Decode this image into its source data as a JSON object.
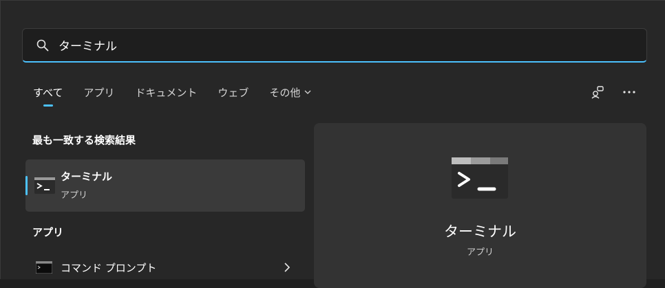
{
  "search": {
    "value": "ターミナル",
    "placeholder": ""
  },
  "tabs": [
    {
      "label": "すべて",
      "active": true
    },
    {
      "label": "アプリ"
    },
    {
      "label": "ドキュメント"
    },
    {
      "label": "ウェブ"
    },
    {
      "label": "その他"
    }
  ],
  "tools": {
    "account_icon": "accounts-icon",
    "more_icon": "more-options-icon"
  },
  "best_match": {
    "section_title": "最も一致する検索結果",
    "name": "ターミナル",
    "type": "アプリ",
    "icon": "terminal-icon"
  },
  "apps": {
    "section_title": "アプリ",
    "items": [
      {
        "name": "コマンド プロンプト",
        "icon": "command-prompt-icon"
      }
    ]
  },
  "preview": {
    "name": "ターミナル",
    "type": "アプリ",
    "icon": "terminal-icon"
  },
  "colors": {
    "accent": "#4cc2ff",
    "background": "#272727",
    "card": "#333333",
    "selected": "#3a3a3a"
  }
}
